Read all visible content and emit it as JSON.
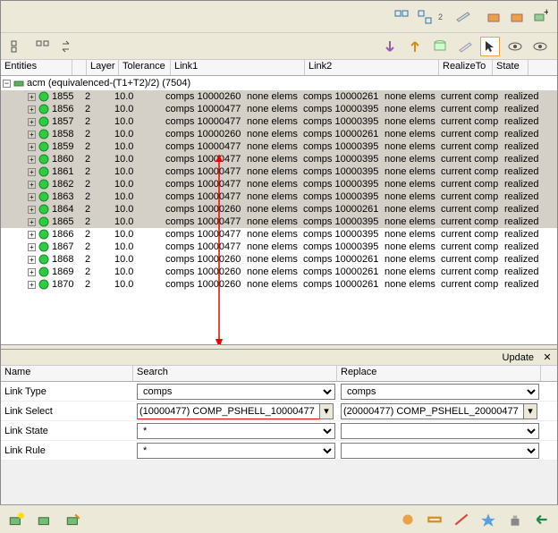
{
  "columns": {
    "entities": "Entities",
    "layer": "Layer",
    "tolerance": "Tolerance",
    "link1": "Link1",
    "link2": "Link2",
    "realizeto": "RealizeTo",
    "state": "State"
  },
  "tree_root": "acm (equivalenced-(T1+T2)/2) (7504)",
  "rows": [
    {
      "id": "1855",
      "layer": "2",
      "tol": "10.0",
      "l1": "comps 10000260",
      "l1m": "none elems",
      "l2": "comps 10000261",
      "l2m": "none elems",
      "rt": "current comp",
      "st": "realized",
      "sel": true,
      "ul": false
    },
    {
      "id": "1856",
      "layer": "2",
      "tol": "10.0",
      "l1": "comps 10000477",
      "l1m": "none elems",
      "l2": "comps 10000395",
      "l2m": "none elems",
      "rt": "current comp",
      "st": "realized",
      "sel": true,
      "ul": true
    },
    {
      "id": "1857",
      "layer": "2",
      "tol": "10.0",
      "l1": "comps 10000477",
      "l1m": "none elems",
      "l2": "comps 10000395",
      "l2m": "none elems",
      "rt": "current comp",
      "st": "realized",
      "sel": true,
      "ul": true
    },
    {
      "id": "1858",
      "layer": "2",
      "tol": "10.0",
      "l1": "comps 10000260",
      "l1m": "none elems",
      "l2": "comps 10000261",
      "l2m": "none elems",
      "rt": "current comp",
      "st": "realized",
      "sel": true,
      "ul": true
    },
    {
      "id": "1859",
      "layer": "2",
      "tol": "10.0",
      "l1": "comps 10000477",
      "l1m": "none elems",
      "l2": "comps 10000395",
      "l2m": "none elems",
      "rt": "current comp",
      "st": "realized",
      "sel": true,
      "ul": true
    },
    {
      "id": "1860",
      "layer": "2",
      "tol": "10.0",
      "l1": "comps 10000477",
      "l1m": "none elems",
      "l2": "comps 10000395",
      "l2m": "none elems",
      "rt": "current comp",
      "st": "realized",
      "sel": true,
      "ul": true
    },
    {
      "id": "1861",
      "layer": "2",
      "tol": "10.0",
      "l1": "comps 10000477",
      "l1m": "none elems",
      "l2": "comps 10000395",
      "l2m": "none elems",
      "rt": "current comp",
      "st": "realized",
      "sel": true,
      "ul": false
    },
    {
      "id": "1862",
      "layer": "2",
      "tol": "10.0",
      "l1": "comps 10000477",
      "l1m": "none elems",
      "l2": "comps 10000395",
      "l2m": "none elems",
      "rt": "current comp",
      "st": "realized",
      "sel": true,
      "ul": true
    },
    {
      "id": "1863",
      "layer": "2",
      "tol": "10.0",
      "l1": "comps 10000477",
      "l1m": "none elems",
      "l2": "comps 10000395",
      "l2m": "none elems",
      "rt": "current comp",
      "st": "realized",
      "sel": true,
      "ul": true
    },
    {
      "id": "1864",
      "layer": "2",
      "tol": "10.0",
      "l1": "comps 10000260",
      "l1m": "none elems",
      "l2": "comps 10000261",
      "l2m": "none elems",
      "rt": "current comp",
      "st": "realized",
      "sel": true,
      "ul": false
    },
    {
      "id": "1865",
      "layer": "2",
      "tol": "10.0",
      "l1": "comps 10000477",
      "l1m": "none elems",
      "l2": "comps 10000395",
      "l2m": "none elems",
      "rt": "current comp",
      "st": "realized",
      "sel": true,
      "ul": true
    },
    {
      "id": "1866",
      "layer": "2",
      "tol": "10.0",
      "l1": "comps 10000477",
      "l1m": "none elems",
      "l2": "comps 10000395",
      "l2m": "none elems",
      "rt": "current comp",
      "st": "realized",
      "sel": false,
      "ul": false
    },
    {
      "id": "1867",
      "layer": "2",
      "tol": "10.0",
      "l1": "comps 10000477",
      "l1m": "none elems",
      "l2": "comps 10000395",
      "l2m": "none elems",
      "rt": "current comp",
      "st": "realized",
      "sel": false,
      "ul": false
    },
    {
      "id": "1868",
      "layer": "2",
      "tol": "10.0",
      "l1": "comps 10000260",
      "l1m": "none elems",
      "l2": "comps 10000261",
      "l2m": "none elems",
      "rt": "current comp",
      "st": "realized",
      "sel": false,
      "ul": false
    },
    {
      "id": "1869",
      "layer": "2",
      "tol": "10.0",
      "l1": "comps 10000260",
      "l1m": "none elems",
      "l2": "comps 10000261",
      "l2m": "none elems",
      "rt": "current comp",
      "st": "realized",
      "sel": false,
      "ul": false
    },
    {
      "id": "1870",
      "layer": "2",
      "tol": "10.0",
      "l1": "comps 10000260",
      "l1m": "none elems",
      "l2": "comps 10000261",
      "l2m": "none elems",
      "rt": "current comp",
      "st": "realized",
      "sel": false,
      "ul": false
    }
  ],
  "update_title": "Update",
  "form_labels": {
    "name": "Name",
    "search": "Search",
    "replace": "Replace",
    "link_type": "Link Type",
    "link_select": "Link Select",
    "link_state": "Link State",
    "link_rule": "Link Rule"
  },
  "form_values": {
    "link_type_search": "comps",
    "link_type_replace": "comps",
    "link_select_search": "(10000477) COMP_PSHELL_10000477",
    "link_select_replace": "(20000477) COMP_PSHELL_20000477",
    "link_state_search": "*",
    "link_state_replace": "",
    "link_rule_search": "*",
    "link_rule_replace": ""
  }
}
